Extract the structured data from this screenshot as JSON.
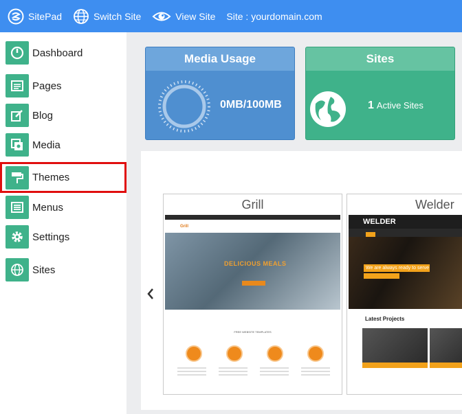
{
  "topbar": {
    "logo_label": "SitePad",
    "switch_label": "Switch Site",
    "view_label": "View Site",
    "site_label": "Site : yourdomain.com"
  },
  "sidebar": {
    "items": [
      {
        "label": "Dashboard"
      },
      {
        "label": "Pages"
      },
      {
        "label": "Blog"
      },
      {
        "label": "Media"
      },
      {
        "label": "Themes"
      },
      {
        "label": "Menus"
      },
      {
        "label": "Settings"
      },
      {
        "label": "Sites"
      }
    ],
    "active": "Themes"
  },
  "cards": {
    "media": {
      "title": "Media Usage",
      "usage": "0MB/100MB"
    },
    "sites": {
      "title": "Sites",
      "count": "1",
      "count_label": "Active Sites"
    }
  },
  "themes": [
    {
      "name": "Grill",
      "preview": {
        "brand": "Grill",
        "headline": "DELICIOUS MEALS",
        "section": "FREE WEBSITE TEMPLATES"
      }
    },
    {
      "name": "Welder",
      "preview": {
        "brand": "WELDER",
        "banner": "We are always ready to serve",
        "section": "Latest Projects"
      }
    }
  ],
  "colors": {
    "topbar": "#3e8ef0",
    "accent_green": "#3fb28a",
    "media_blue": "#4f8fd0",
    "highlight_red": "#e00e0e"
  }
}
